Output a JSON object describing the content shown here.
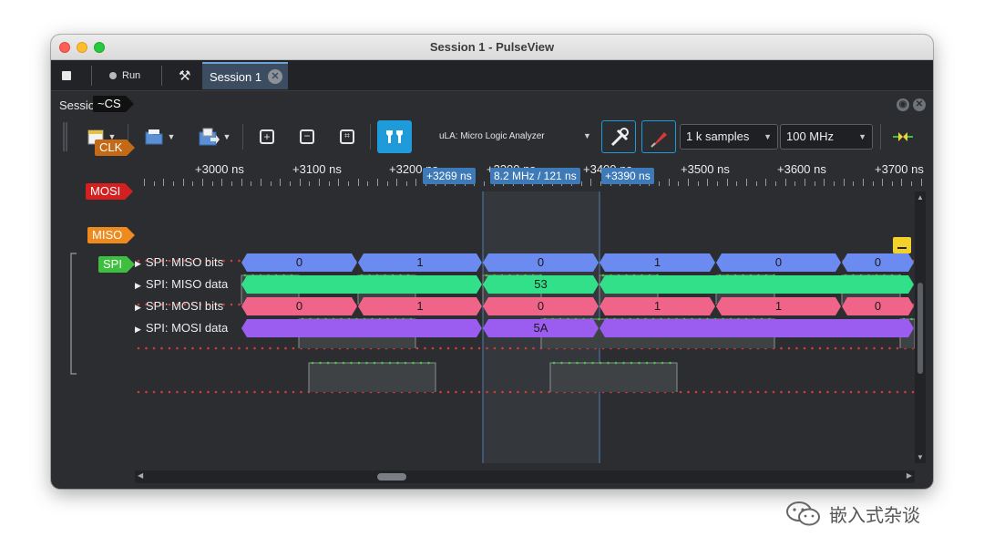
{
  "window": {
    "title": "Session 1 - PulseView"
  },
  "tabbar": {
    "run_label": "Run",
    "session_tab": "Session 1"
  },
  "panel": {
    "title": "Session 1"
  },
  "toolbar": {
    "device": "uLA: Micro Logic Analyzer",
    "samples": "1 k samples",
    "rate": "100 MHz",
    "accent": "#1e9bd8"
  },
  "ruler": {
    "labels": [
      "+3000 ns",
      "+3100 ns",
      "+3200 ns",
      "+3300 ns",
      "+3400 ns",
      "+3500 ns",
      "+3600 ns",
      "+3700 ns"
    ],
    "cursor_a": "+3269 ns",
    "cursor_mid": "8.2 MHz / 121 ns",
    "cursor_b": "+3390 ns"
  },
  "signals": [
    {
      "name": "~CS",
      "color": "#111111",
      "text": "#ffffff"
    },
    {
      "name": "CLK",
      "color": "#c46a16",
      "text": "#ffffff"
    },
    {
      "name": "MOSI",
      "color": "#d42020",
      "text": "#ffffff"
    },
    {
      "name": "MISO",
      "color": "#ef8a1e",
      "text": "#ffffff"
    }
  ],
  "decoder": {
    "name": "SPI",
    "color": "#3fbf3f",
    "rows": [
      {
        "label": "SPI: MISO bits",
        "color": "#6b8bf0",
        "cells": [
          "0",
          "1",
          "0",
          "1",
          "0",
          "0"
        ]
      },
      {
        "label": "SPI: MISO data",
        "color": "#33e08a",
        "cells": [
          "",
          "53",
          ""
        ]
      },
      {
        "label": "SPI: MOSI bits",
        "color": "#f0648a",
        "cells": [
          "0",
          "1",
          "0",
          "1",
          "1",
          "0"
        ]
      },
      {
        "label": "SPI: MOSI data",
        "color": "#9b5cf0",
        "cells": [
          "",
          "5A",
          ""
        ]
      }
    ]
  },
  "watermark": {
    "text": "嵌入式杂谈"
  }
}
